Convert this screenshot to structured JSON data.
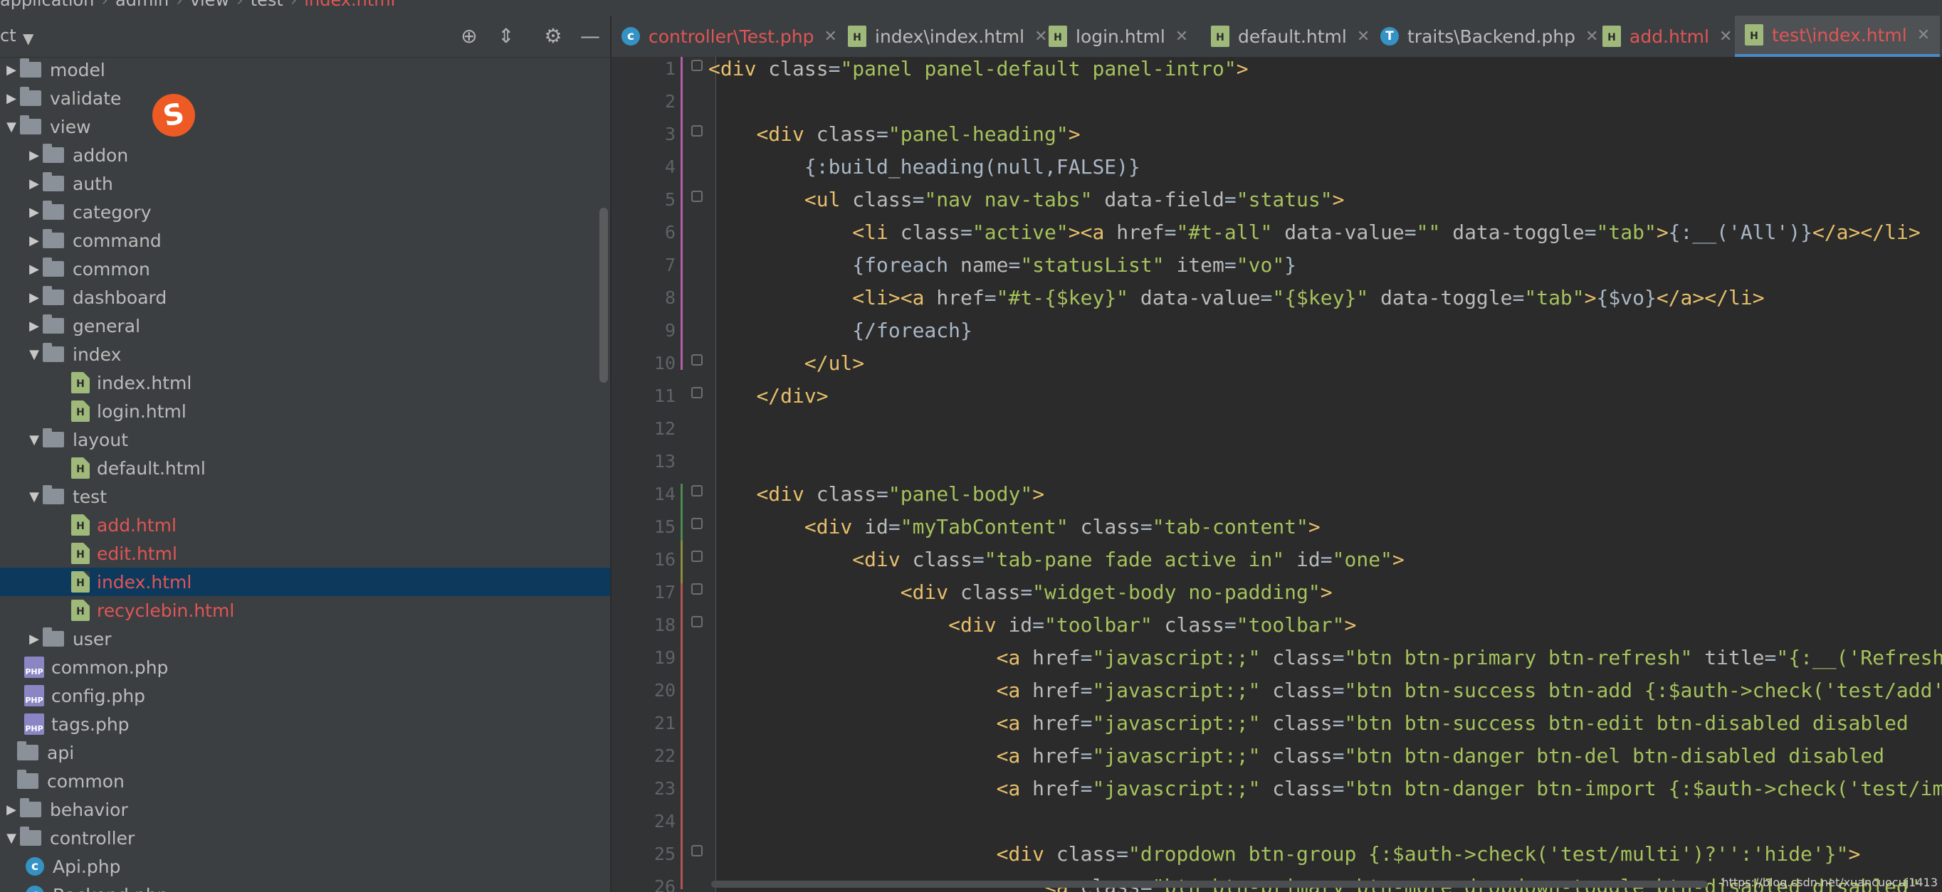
{
  "breadcrumb": [
    "application",
    "admin",
    "view",
    "test",
    "index.html"
  ],
  "sidebar": {
    "title": "ct",
    "items": [
      {
        "label": "model",
        "type": "folder",
        "level": 1,
        "expanded": false
      },
      {
        "label": "validate",
        "type": "folder",
        "level": 1,
        "expanded": false
      },
      {
        "label": "view",
        "type": "folder",
        "level": 1,
        "expanded": true
      },
      {
        "label": "addon",
        "type": "folder",
        "level": 2,
        "expanded": false
      },
      {
        "label": "auth",
        "type": "folder",
        "level": 2,
        "expanded": false
      },
      {
        "label": "category",
        "type": "folder",
        "level": 2,
        "expanded": false
      },
      {
        "label": "command",
        "type": "folder",
        "level": 2,
        "expanded": false
      },
      {
        "label": "common",
        "type": "folder",
        "level": 2,
        "expanded": false
      },
      {
        "label": "dashboard",
        "type": "folder",
        "level": 2,
        "expanded": false
      },
      {
        "label": "general",
        "type": "folder",
        "level": 2,
        "expanded": false
      },
      {
        "label": "index",
        "type": "folder",
        "level": 2,
        "expanded": true
      },
      {
        "label": "index.html",
        "type": "html",
        "level": 3
      },
      {
        "label": "login.html",
        "type": "html",
        "level": 3
      },
      {
        "label": "layout",
        "type": "folder",
        "level": 2,
        "expanded": true
      },
      {
        "label": "default.html",
        "type": "html",
        "level": 3
      },
      {
        "label": "test",
        "type": "folder",
        "level": 2,
        "expanded": true
      },
      {
        "label": "add.html",
        "type": "html",
        "level": 3,
        "modified": true
      },
      {
        "label": "edit.html",
        "type": "html",
        "level": 3,
        "modified": true
      },
      {
        "label": "index.html",
        "type": "html",
        "level": 3,
        "modified": true,
        "selected": true
      },
      {
        "label": "recyclebin.html",
        "type": "html",
        "level": 3,
        "modified": true
      },
      {
        "label": "user",
        "type": "folder",
        "level": 2,
        "expanded": false
      },
      {
        "label": "common.php",
        "type": "php",
        "level": 1
      },
      {
        "label": "config.php",
        "type": "php",
        "level": 1
      },
      {
        "label": "tags.php",
        "type": "php",
        "level": 1
      },
      {
        "label": "api",
        "type": "folder",
        "level": 0,
        "expanded": null
      },
      {
        "label": "common",
        "type": "folder",
        "level": 0,
        "expanded": null
      },
      {
        "label": "behavior",
        "type": "folder",
        "level": 1,
        "expanded": false
      },
      {
        "label": "controller",
        "type": "folder",
        "level": 1,
        "expanded": true
      },
      {
        "label": "Api.php",
        "type": "class",
        "level": 2
      },
      {
        "label": "Backend.php",
        "type": "class",
        "level": 2
      }
    ]
  },
  "tabs": [
    {
      "label": "controller\\Test.php",
      "icon": "php-class-icon",
      "modified": true
    },
    {
      "label": "index\\index.html",
      "icon": "html-file-icon"
    },
    {
      "label": "login.html",
      "icon": "html-file-icon"
    },
    {
      "label": "default.html",
      "icon": "html-file-icon"
    },
    {
      "label": "traits\\Backend.php",
      "icon": "php-trait-icon"
    },
    {
      "label": "add.html",
      "icon": "html-file-icon",
      "modified": true
    },
    {
      "label": "test\\index.html",
      "icon": "html-file-icon",
      "modified": true,
      "active": true
    }
  ],
  "editor": {
    "line_numbers": [
      "1",
      "2",
      "3",
      "4",
      "5",
      "6",
      "7",
      "8",
      "9",
      "10",
      "11",
      "12",
      "13",
      "14",
      "15",
      "16",
      "17",
      "18",
      "19",
      "20",
      "21",
      "22",
      "23",
      "24",
      "25",
      "26"
    ],
    "lines": [
      "<div class=\"panel panel-default panel-intro\">",
      "",
      "    <div class=\"panel-heading\">",
      "        {:build_heading(null,FALSE)}",
      "        <ul class=\"nav nav-tabs\" data-field=\"status\">",
      "            <li class=\"active\"><a href=\"#t-all\" data-value=\"\" data-toggle=\"tab\">{:__('All')}</a></li>",
      "            {foreach name=\"statusList\" item=\"vo\"}",
      "            <li><a href=\"#t-{$key}\" data-value=\"{$key}\" data-toggle=\"tab\">{$vo}</a></li>",
      "            {/foreach}",
      "        </ul>",
      "    </div>",
      "",
      "",
      "    <div class=\"panel-body\">",
      "        <div id=\"myTabContent\" class=\"tab-content\">",
      "            <div class=\"tab-pane fade active in\" id=\"one\">",
      "                <div class=\"widget-body no-padding\">",
      "                    <div id=\"toolbar\" class=\"toolbar\">",
      "                        <a href=\"javascript:;\" class=\"btn btn-primary btn-refresh\" title=\"{:__('Refresh')}\"",
      "                        <a href=\"javascript:;\" class=\"btn btn-success btn-add {:$auth->check('test/add')",
      "                        <a href=\"javascript:;\" class=\"btn btn-success btn-edit btn-disabled disabled",
      "                        <a href=\"javascript:;\" class=\"btn btn-danger btn-del btn-disabled disabled",
      "                        <a href=\"javascript:;\" class=\"btn btn-danger btn-import {:$auth->check('test/import')",
      "",
      "                        <div class=\"dropdown btn-group {:$auth->check('test/multi')?'':'hide'}\">",
      "                            <a class=\"btn btn-primary btn-more dropdown-toggle btn-disabled disabled\""
    ]
  },
  "watermark": "https://blog.csdn.net/xuancuocuj1413"
}
